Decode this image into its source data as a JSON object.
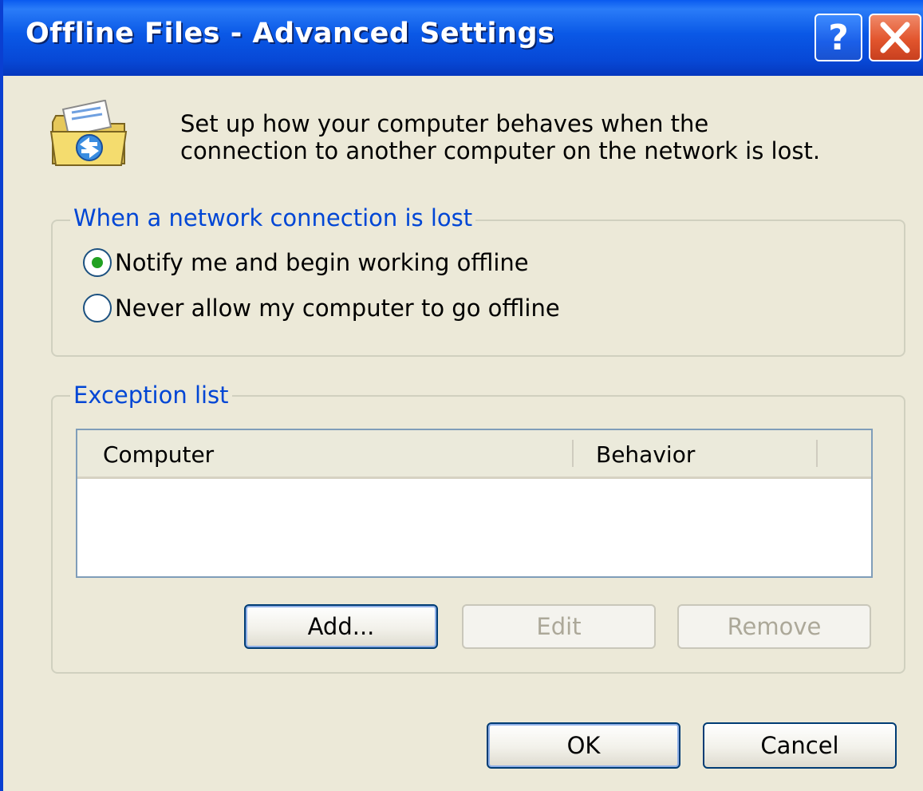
{
  "window": {
    "title": "Offline Files - Advanced Settings",
    "help_label": "?",
    "close_label": "close"
  },
  "intro": {
    "icon": "offline-files-folder-sync-icon",
    "text": "Set up how your computer behaves when the connection to another computer on the network is lost."
  },
  "network_group": {
    "label": "When a network connection is lost",
    "options": [
      {
        "label": "Notify me and begin working offline",
        "selected": true
      },
      {
        "label": "Never allow my computer to go offline",
        "selected": false
      }
    ]
  },
  "exception_group": {
    "label": "Exception list",
    "columns": [
      "Computer",
      "Behavior"
    ],
    "rows": [],
    "buttons": {
      "add": "Add...",
      "edit": "Edit",
      "remove": "Remove"
    }
  },
  "footer": {
    "ok": "OK",
    "cancel": "Cancel"
  },
  "colors": {
    "titlebar": "#0a58e6",
    "dialog_bg": "#ece9d8",
    "group_label": "#0046d5",
    "radio_selected": "#21a121",
    "close_button": "#e2552d"
  }
}
